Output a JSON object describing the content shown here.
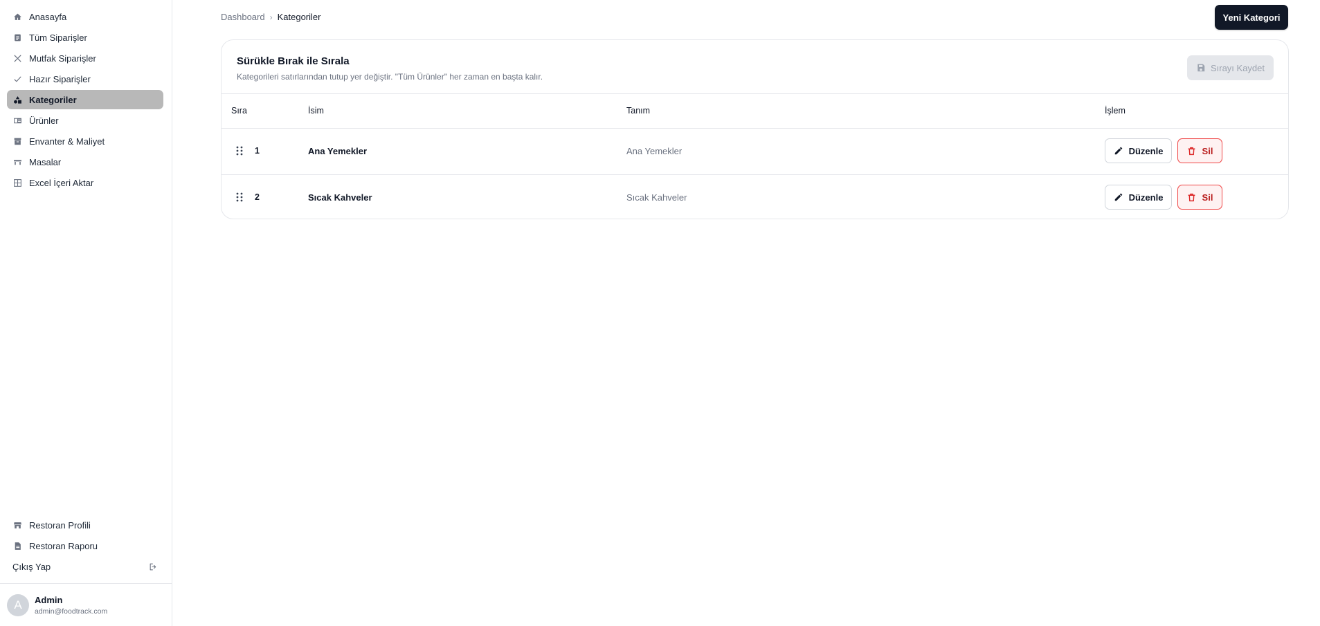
{
  "sidebar": {
    "items": [
      {
        "label": "Anasayfa",
        "icon": "home-icon"
      },
      {
        "label": "Tüm Siparişler",
        "icon": "clipboard-icon"
      },
      {
        "label": "Mutfak Siparişler",
        "icon": "utensils-icon"
      },
      {
        "label": "Hazır Siparişler",
        "icon": "check-icon"
      },
      {
        "label": "Kategoriler",
        "icon": "shapes-icon",
        "active": true
      },
      {
        "label": "Ürünler",
        "icon": "product-icon"
      },
      {
        "label": "Envanter & Maliyet",
        "icon": "archive-icon"
      },
      {
        "label": "Masalar",
        "icon": "table-icon"
      },
      {
        "label": "Excel İçeri Aktar",
        "icon": "grid-icon"
      }
    ],
    "bottom_items": [
      {
        "label": "Restoran Profili",
        "icon": "store-icon"
      },
      {
        "label": "Restoran Raporu",
        "icon": "report-icon"
      }
    ],
    "logout_label": "Çıkış Yap",
    "user": {
      "initial": "A",
      "name": "Admin",
      "email": "admin@foodtrack.com"
    }
  },
  "header": {
    "breadcrumb_root": "Dashboard",
    "breadcrumb_current": "Kategoriler",
    "new_button": "Yeni Kategori"
  },
  "card": {
    "title": "Sürükle Bırak ile Sırala",
    "subtitle": "Kategorileri satırlarından tutup yer değiştir. \"Tüm Ürünler\" her zaman en başta kalır.",
    "save_button": "Sırayı Kaydet",
    "columns": [
      "Sıra",
      "İsim",
      "Tanım",
      "İşlem"
    ],
    "rows": [
      {
        "order": "1",
        "name": "Ana Yemekler",
        "description": "Ana Yemekler"
      },
      {
        "order": "2",
        "name": "Sıcak Kahveler",
        "description": "Sıcak Kahveler"
      }
    ],
    "edit_label": "Düzenle",
    "delete_label": "Sil"
  },
  "colors": {
    "primary": "#111827",
    "active_nav": "#b8b8b8",
    "danger": "#dc2626"
  }
}
